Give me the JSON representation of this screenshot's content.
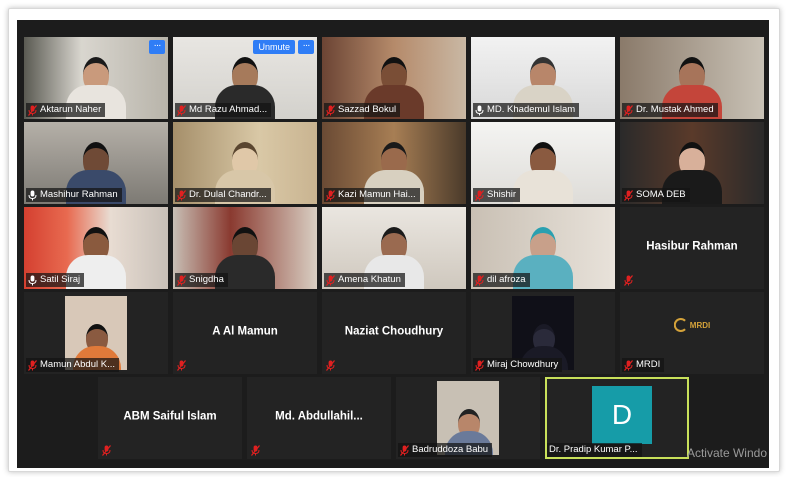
{
  "colors": {
    "stage_bg": "#1c1c1c",
    "tile_bg": "#232323",
    "accent_blue": "#2f7df6",
    "active_speaker_border": "#c8e05a",
    "avatar_d_bg": "#169ca8",
    "muted_mic_red": "#e02020"
  },
  "tiles": [
    {
      "name": "Aktarun Naher",
      "muted": true,
      "video": true,
      "has_menu": true
    },
    {
      "name": "Md Razu Ahmad...",
      "muted": true,
      "video": true,
      "unmute_label": "Unmute",
      "has_menu": true
    },
    {
      "name": "Sazzad Bokul",
      "muted": true,
      "video": true
    },
    {
      "name": "MD. Khademul Islam",
      "muted": false,
      "video": true
    },
    {
      "name": "Dr. Mustak Ahmed",
      "muted": true,
      "video": true
    },
    {
      "name": "Mashihur Rahman",
      "muted": false,
      "video": true
    },
    {
      "name": "Dr. Dulal Chandr...",
      "muted": true,
      "video": true
    },
    {
      "name": "Kazi Mamun Hai...",
      "muted": true,
      "video": true
    },
    {
      "name": "Shishir",
      "muted": true,
      "video": true
    },
    {
      "name": "SOMA DEB",
      "muted": true,
      "video": true
    },
    {
      "name": "Satil Siraj",
      "muted": false,
      "video": true
    },
    {
      "name": "Snigdha",
      "muted": true,
      "video": true
    },
    {
      "name": "Amena Khatun",
      "muted": true,
      "video": true
    },
    {
      "name": "dil afroza",
      "muted": true,
      "video": true
    },
    {
      "name": "Hasibur Rahman",
      "muted": true,
      "video": false
    },
    {
      "name": "Mamun Abdul K...",
      "muted": true,
      "video": true
    },
    {
      "name": "A Al Mamun",
      "muted": true,
      "video": false
    },
    {
      "name": "Naziat Choudhury",
      "muted": true,
      "video": false
    },
    {
      "name": "Miraj Chowdhury",
      "muted": true,
      "video": true
    },
    {
      "name": "MRDI",
      "muted": true,
      "video": true,
      "logo_text": "MRDI"
    },
    {
      "name": "ABM Saiful Islam",
      "muted": true,
      "video": false
    },
    {
      "name": "Md.  Abdullahil...",
      "muted": true,
      "video": false
    },
    {
      "name": "Badruddoza Babu",
      "muted": true,
      "video": true
    },
    {
      "name": "Dr. Pradip Kumar P...",
      "muted": false,
      "video": false,
      "avatar_letter": "D",
      "active": true
    }
  ],
  "menu_dots": "···",
  "watermark": "Activate Windo"
}
